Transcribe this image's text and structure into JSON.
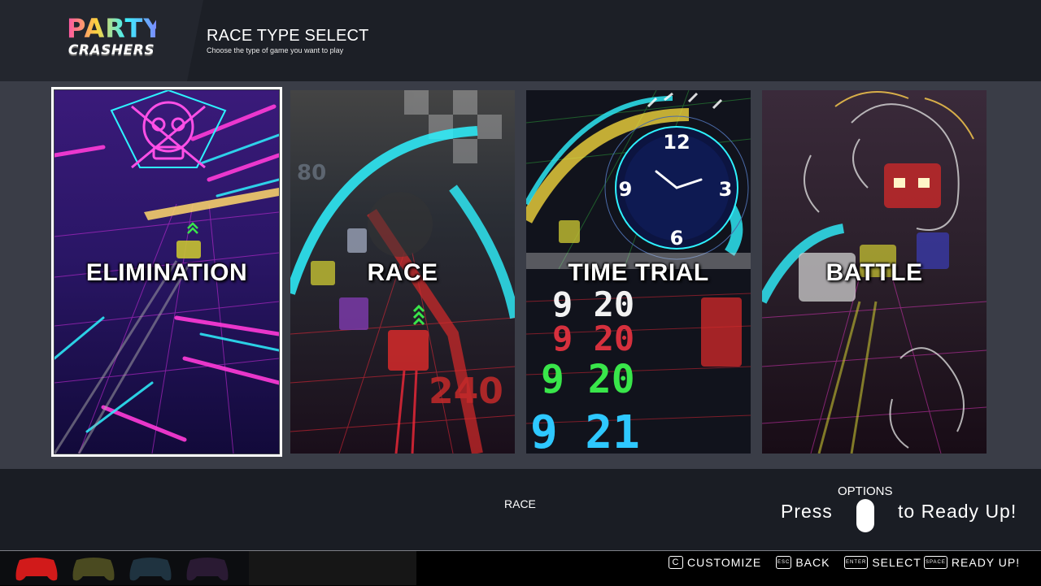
{
  "logo": {
    "line1": "PARTY",
    "line2": "CRASHERS"
  },
  "header": {
    "title": "RACE TYPE SELECT",
    "subtitle": "Choose the type of game you want to play"
  },
  "cards": [
    {
      "label": "ELIMINATION",
      "selected": true
    },
    {
      "label": "RACE",
      "selected": false,
      "speedometer_text": "240",
      "speed_mark_text": "80"
    },
    {
      "label": "TIME TRIAL",
      "selected": false,
      "clock_numbers": [
        "12",
        "3",
        "6",
        "9"
      ],
      "times": [
        "9 20",
        "9 20",
        "9 20",
        "9 21"
      ]
    },
    {
      "label": "BATTLE",
      "selected": false
    }
  ],
  "bottom": {
    "current_mode": "RACE",
    "options_label": "OPTIONS",
    "ready_prefix": "Press",
    "ready_suffix": "to Ready Up!"
  },
  "footer": {
    "controllers": [
      {
        "color": "#d11a1a",
        "active": true
      },
      {
        "color": "#4a4a20",
        "active": false
      },
      {
        "color": "#1f3340",
        "active": false
      },
      {
        "color": "#2a1a33",
        "active": false
      }
    ],
    "hints": [
      {
        "key": "C",
        "label": "CUSTOMIZE"
      },
      {
        "key": "ESC",
        "label": "BACK"
      },
      {
        "key": "ENTER",
        "label": "SELECT"
      },
      {
        "key": "SPACE",
        "label": "READY UP!"
      }
    ]
  },
  "colors": {
    "header_bg": "#1c1f26",
    "cards_bg": "#3a3d47",
    "neon_pink": "#ff3bd8",
    "neon_cyan": "#2ef2ff",
    "neon_green": "#39e64a",
    "neon_red": "#ff2a3a"
  }
}
